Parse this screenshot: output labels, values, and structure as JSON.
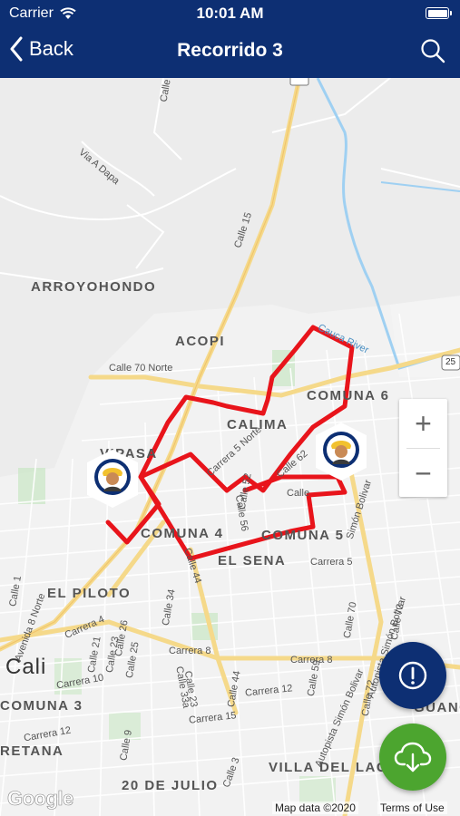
{
  "status_bar": {
    "carrier": "Carrier",
    "time": "10:01 AM"
  },
  "nav": {
    "back_label": "Back",
    "title": "Recorrido 3"
  },
  "map": {
    "areas": {
      "arroyohondo": "ARROYOHONDO",
      "acopi": "ACOPI",
      "comuna6": "COMUNA 6",
      "calima": "CALIMA",
      "vipasa": "VIPASA",
      "comuna4": "COMUNA 4",
      "comuna5": "COMUNA 5",
      "el_sena": "EL SENA",
      "el_piloto": "EL PILOTO",
      "comuna3": "COMUNA 3",
      "retana": "RETANA",
      "veinte_julio": "20 DE JULIO",
      "villa_del_lago": "VILLA DEL LAGO",
      "guanca": "GUANC"
    },
    "city": "Cali",
    "streets": {
      "calle15": "Calle 15",
      "via_dapa": "Via A Dapa",
      "calle_top": "Calle",
      "calle70n": "Calle 70 Norte",
      "carrera5n": "Carrera 5 Norte",
      "calle44": "Calle 44",
      "calle52": "Calle 52",
      "calle56": "Calle 56",
      "calle62": "Calle 62",
      "calle_b": "Calle",
      "carrera5": "Carrera 5",
      "simon_bolivar_top": "Simón Bolivar",
      "carrera8_a": "Carrera 8",
      "carrera8_b": "Carrera 8",
      "autopista_simon_bolivar": "Autopista Simón Bolivar",
      "autopista_simon_bolivar_2": "Autopista Simón Bolivar",
      "calle34": "Calle 34",
      "calle73": "Calle 73",
      "calle70": "Calle 70",
      "calle72": "Calle 72",
      "calle59": "Calle 59",
      "calle44b": "Calle 44",
      "calle33a": "Calle 33a",
      "calle26": "Calle 26",
      "calle21": "Calle 21",
      "calle23": "Calle 23",
      "calle25": "Calle 25",
      "carrera4": "Carrera 4",
      "carrera10": "Carrera 10",
      "carrera12": "Carrera 12",
      "carrera15": "Carrera 15",
      "carrera12b": "Carrera 12",
      "calle9": "Calle 9",
      "calle_left": "Calle 1",
      "avenida8n": "Avenida 8 Norte",
      "cauca_river": "Cauca River",
      "route25": "25",
      "calle23b": "Calle 23",
      "calle_x": "Calle 3"
    },
    "route_color": "#e8141b",
    "google_logo": "Google",
    "attribution": "Map data ©2020",
    "terms": "Terms of Use"
  },
  "zoom": {
    "in": "+",
    "out": "−"
  },
  "colors": {
    "header": "#0d2f73",
    "alert_fab": "#0d2f73",
    "download_fab": "#4ca52f"
  },
  "icons": {
    "back": "chevron-left-icon",
    "search": "search-icon",
    "alert": "exclamation-icon",
    "download": "cloud-download-icon"
  }
}
